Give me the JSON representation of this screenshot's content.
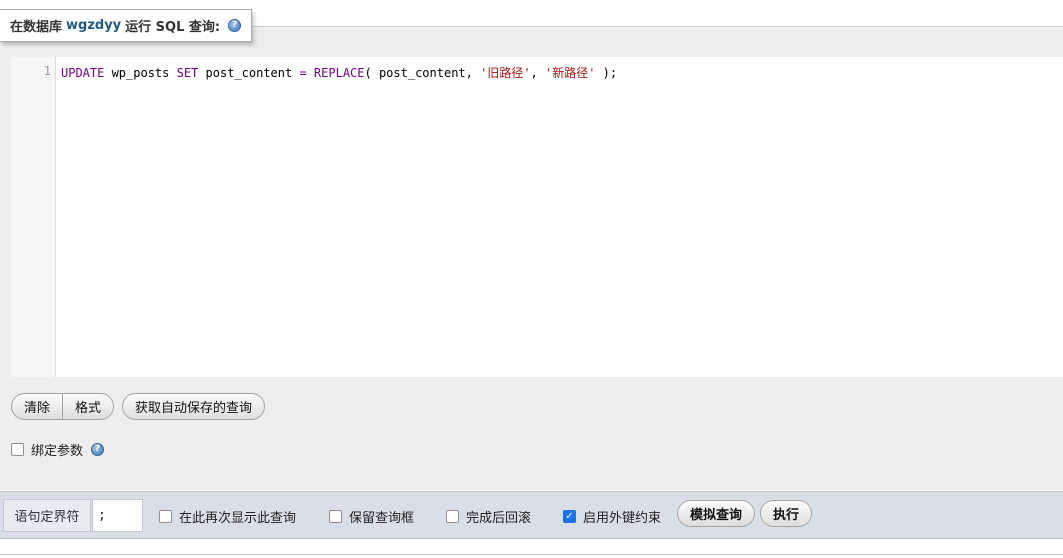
{
  "legend": {
    "prefix": "在数据库",
    "database": "wgzdyy",
    "suffix": "运行 SQL 查询:",
    "help_icon": "help-icon"
  },
  "editor": {
    "line_number": "1",
    "tokens": {
      "t1": "UPDATE",
      "t2": " wp_posts ",
      "t3": "SET",
      "t4": " post_content ",
      "t5": "=",
      "t6": " ",
      "t7": "REPLACE",
      "t8": "( post_content, ",
      "t9": "'旧路径'",
      "t10": ", ",
      "t11": "'新路径'",
      "t12": " );"
    }
  },
  "buttons": {
    "clear": "清除",
    "format": "格式",
    "autosave": "获取自动保存的查询",
    "simulate": "模拟查询",
    "execute": "执行"
  },
  "bind_params": {
    "label": "绑定参数",
    "checked": false
  },
  "bottom": {
    "delimiter_label": "语句定界符",
    "delimiter_value": ";",
    "options": {
      "show_again": {
        "label": "在此再次显示此查询",
        "checked": false
      },
      "retain_box": {
        "label": "保留查询框",
        "checked": false
      },
      "rollback": {
        "label": "完成后回滚",
        "checked": false
      },
      "fk_checks": {
        "label": "启用外键约束",
        "checked": true
      }
    }
  },
  "colors": {
    "keyword": "#770088",
    "string": "#aa1111",
    "db_name": "#235a81",
    "checkbox_checked": "#1a73e8"
  }
}
